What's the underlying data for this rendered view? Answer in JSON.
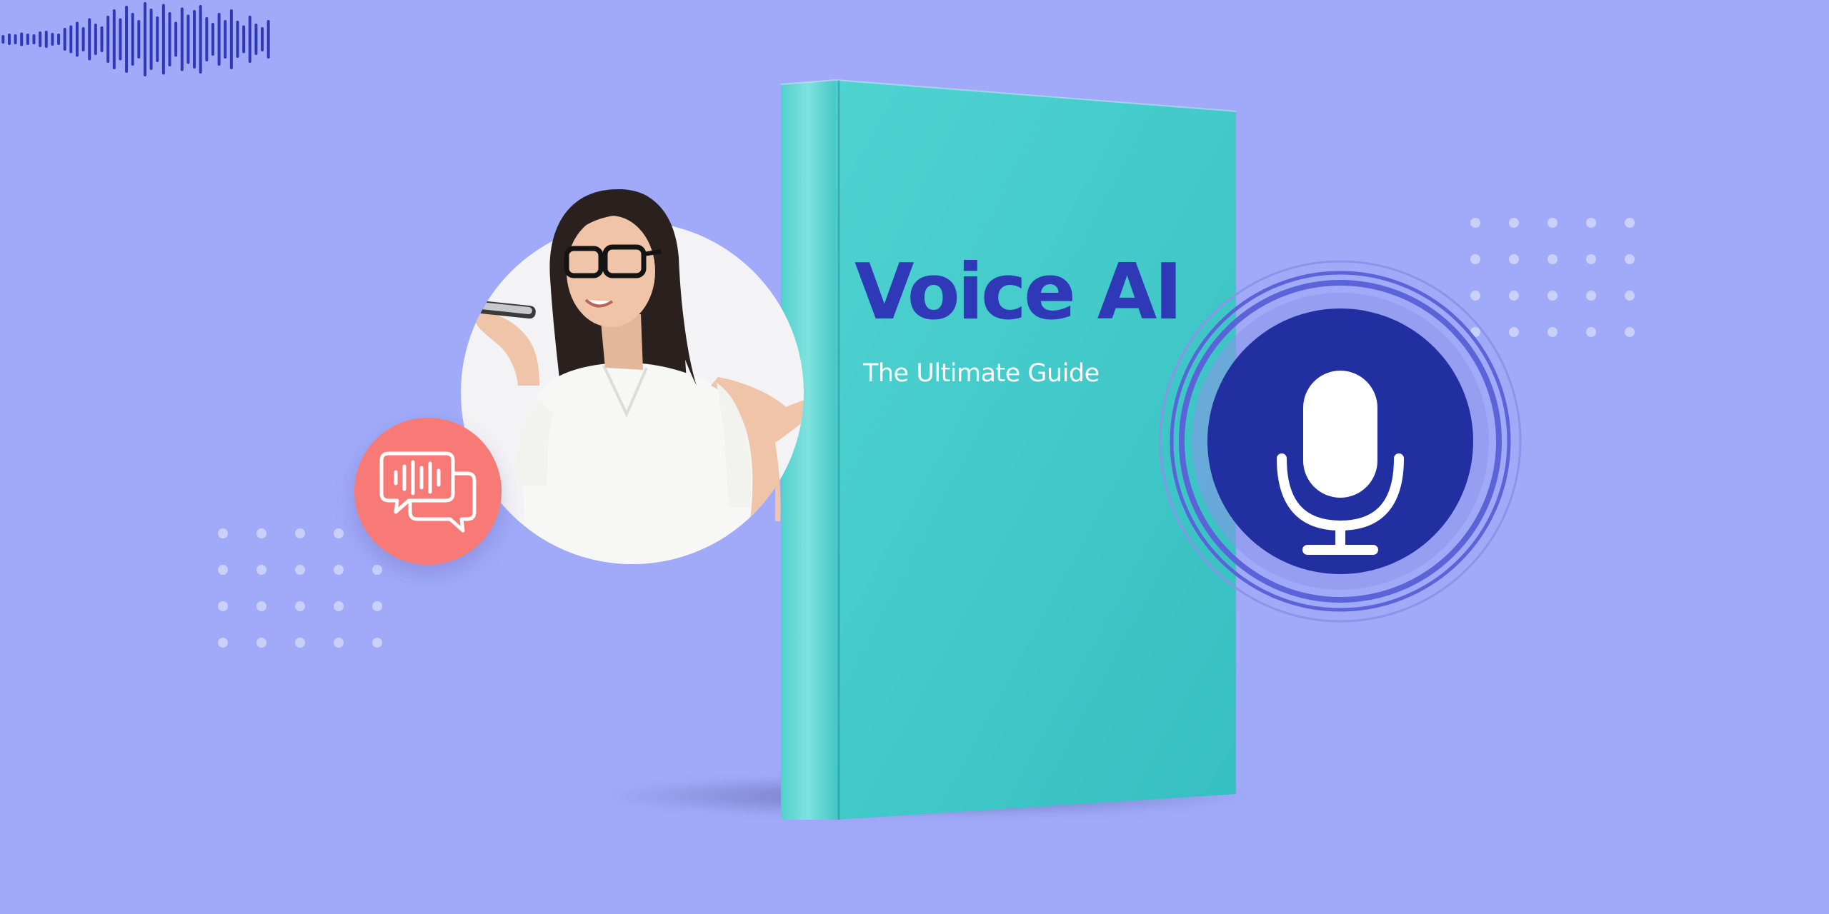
{
  "colors": {
    "background": "#a0aaf8",
    "book_cover": "#3ec9c8",
    "book_spine": "#6ddcda",
    "title": "#2f39b7",
    "subtitle": "#ffffff",
    "waveform": "#2f39b7",
    "mic_circle": "#222fa0",
    "mic_ring": "#5b63d8",
    "chat_badge": "#f77a77",
    "photo_disc": "#f3f3f6"
  },
  "book": {
    "title": "Voice AI",
    "subtitle": "The Ultimate Guide"
  },
  "icons": {
    "chat": "chat-soundwave-icon",
    "mic": "microphone-icon",
    "waveform": "soundwave-icon"
  },
  "waveform_levels": [
    0.08,
    0.12,
    0.1,
    0.15,
    0.12,
    0.1,
    0.18,
    0.2,
    0.14,
    0.12,
    0.28,
    0.35,
    0.45,
    0.3,
    0.55,
    0.4,
    0.32,
    0.62,
    0.8,
    0.55,
    0.9,
    0.7,
    0.5,
    1.0,
    0.82,
    0.6,
    0.95,
    0.72,
    0.45,
    0.85,
    0.65,
    0.78,
    0.92,
    0.58,
    0.42,
    0.7,
    0.5,
    0.8,
    0.48,
    0.35,
    0.62,
    0.4,
    0.3,
    0.5
  ]
}
